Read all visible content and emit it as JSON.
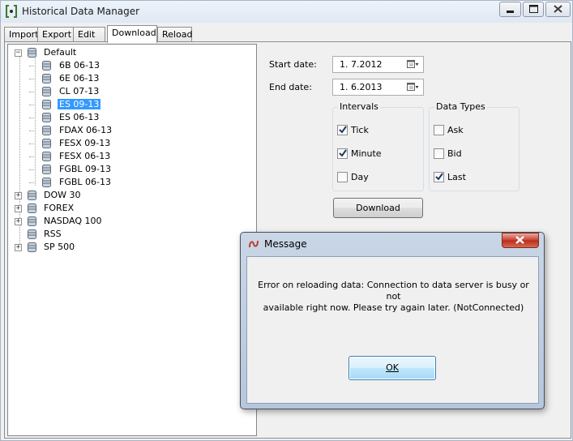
{
  "window": {
    "title": "Historical Data Manager"
  },
  "tabs": [
    {
      "label": "Import",
      "active": false
    },
    {
      "label": "Export",
      "active": false
    },
    {
      "label": "Edit",
      "active": false
    },
    {
      "label": "Download",
      "active": true
    },
    {
      "label": "Reload",
      "active": false
    }
  ],
  "tree": {
    "root": {
      "label": "Default",
      "expanded": true
    },
    "children": [
      "6B 06-13",
      "6E 06-13",
      "CL 07-13",
      "ES 09-13",
      "ES 06-13",
      "FDAX 06-13",
      "FESX 09-13",
      "FESX 06-13",
      "FGBL 09-13",
      "FGBL 06-13"
    ],
    "selected": "ES 09-13",
    "groups": [
      {
        "label": "DOW 30",
        "collapsed": true
      },
      {
        "label": "FOREX",
        "collapsed": true
      },
      {
        "label": "NASDAQ 100",
        "collapsed": true
      },
      {
        "label": "RSS",
        "collapsed": false
      },
      {
        "label": "SP 500",
        "collapsed": true
      }
    ]
  },
  "form": {
    "start_label": "Start date:",
    "start_value": "1.  7.2012",
    "end_label": "End date:",
    "end_value": "1.  6.2013",
    "intervals_title": "Intervals",
    "intervals": [
      {
        "label": "Tick",
        "checked": true
      },
      {
        "label": "Minute",
        "checked": true
      },
      {
        "label": "Day",
        "checked": false
      }
    ],
    "types_title": "Data Types",
    "types": [
      {
        "label": "Ask",
        "checked": false
      },
      {
        "label": "Bid",
        "checked": false
      },
      {
        "label": "Last",
        "checked": true
      }
    ],
    "download_label": "Download"
  },
  "dialog": {
    "title": "Message",
    "message_line1": "Error on reloading data: Connection to data server is busy or not",
    "message_line2": "available right now. Please try again later. (NotConnected)",
    "ok_label": "OK"
  },
  "colors": {
    "selection": "#3399ff",
    "close_red": "#c7402f",
    "window_bg": "#f0f0f0"
  }
}
